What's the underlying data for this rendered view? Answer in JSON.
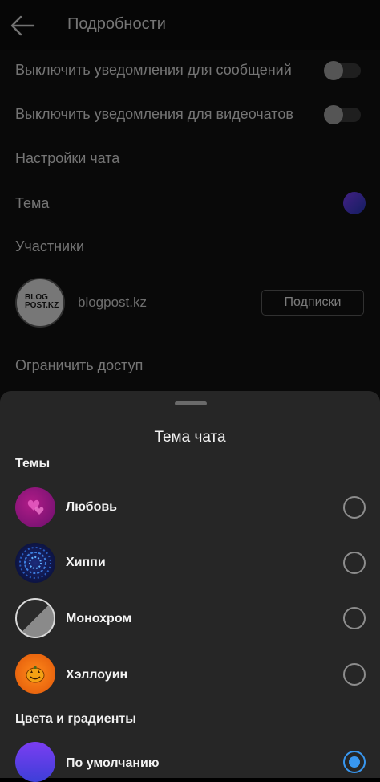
{
  "header": {
    "title": "Подробности",
    "back_icon": "arrow-left-icon"
  },
  "settings": {
    "mute_messages": "Выключить уведомления для сообщений",
    "mute_videochats": "Выключить уведомления для видеочатов",
    "chat_settings": "Настройки чата",
    "theme": "Тема",
    "members": "Участники",
    "restrict": "Ограничить доступ"
  },
  "member": {
    "avatar_text_1": "BLOG",
    "avatar_text_2": "POST.KZ",
    "name": "blogpost.kz",
    "button": "Подписки"
  },
  "sheet": {
    "title": "Тема чата",
    "themes_heading": "Темы",
    "themes": [
      {
        "label": "Любовь",
        "selected": false
      },
      {
        "label": "Хиппи",
        "selected": false
      },
      {
        "label": "Монохром",
        "selected": false
      },
      {
        "label": "Хэллоуин",
        "selected": false
      }
    ],
    "colors_heading": "Цвета и градиенты",
    "colors": [
      {
        "label": "По умолчанию",
        "selected": true
      }
    ]
  },
  "colors": {
    "accent": "#3897f0",
    "sheet_bg": "#262626"
  }
}
